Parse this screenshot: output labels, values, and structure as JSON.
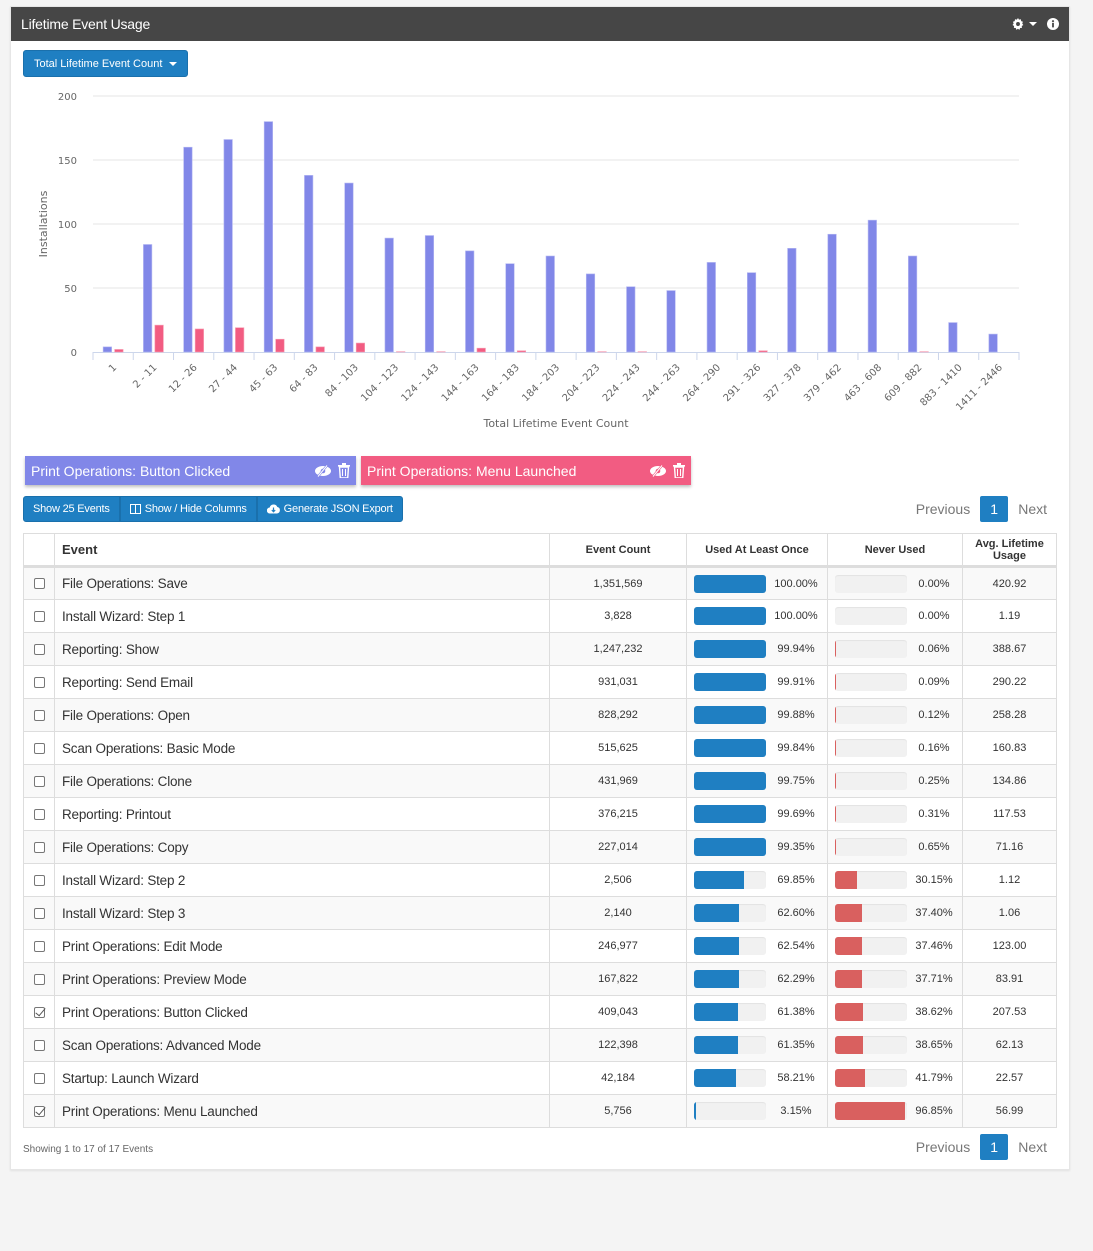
{
  "panel": {
    "title": "Lifetime Event Usage",
    "header_icons": [
      "gear-icon",
      "caret-down-icon",
      "info-icon"
    ],
    "metric_button": "Total Lifetime Event Count"
  },
  "chart_data": {
    "type": "bar",
    "title": "",
    "xlabel": "Total Lifetime Event Count",
    "ylabel": "Installations",
    "ylim": [
      0,
      200
    ],
    "yticks": [
      0,
      50,
      100,
      150,
      200
    ],
    "grid": true,
    "categories": [
      "1",
      "2 - 11",
      "12 - 26",
      "27 - 44",
      "45 - 63",
      "64 - 83",
      "84 - 103",
      "104 - 123",
      "124 - 143",
      "144 - 163",
      "164 - 183",
      "184 - 203",
      "204 - 223",
      "224 - 243",
      "244 - 263",
      "264 - 290",
      "291 - 326",
      "327 - 378",
      "379 - 462",
      "463 - 608",
      "609 - 882",
      "883 - 1410",
      "1411 - 2446"
    ],
    "series": [
      {
        "name": "Print Operations: Button Clicked",
        "color": "#8187e8",
        "values": [
          4,
          84,
          160,
          166,
          180,
          138,
          132,
          89,
          91,
          79,
          69,
          75,
          61,
          51,
          48,
          70,
          62,
          81,
          92,
          103,
          75,
          23,
          14
        ]
      },
      {
        "name": "Print Operations: Menu Launched",
        "color": "#f25c82",
        "values": [
          2,
          21,
          18,
          19,
          10,
          4,
          7,
          0.3,
          0.3,
          3,
          1,
          0,
          0.3,
          0.3,
          0,
          0,
          1,
          0,
          0,
          0,
          0.3,
          0,
          0
        ]
      }
    ]
  },
  "legend": [
    {
      "label": "Print Operations: Button Clicked",
      "color": "#8187e8"
    },
    {
      "label": "Print Operations: Menu Launched",
      "color": "#f25c82"
    }
  ],
  "toolbar": {
    "show_events": "Show 25 Events",
    "show_hide_columns": "Show / Hide Columns",
    "export": "Generate JSON Export"
  },
  "pagination": {
    "previous": "Previous",
    "current": "1",
    "next": "Next"
  },
  "table": {
    "headers": [
      "",
      "Event",
      "Event Count",
      "Used At Least Once",
      "Never Used",
      "Avg. Lifetime Usage"
    ],
    "rows": [
      {
        "checked": false,
        "event": "File Operations: Save",
        "count": "1,351,569",
        "used": 100.0,
        "used_label": "100.00%",
        "never": 0.0,
        "never_label": "0.00%",
        "avg": "420.92"
      },
      {
        "checked": false,
        "event": "Install Wizard: Step 1",
        "count": "3,828",
        "used": 100.0,
        "used_label": "100.00%",
        "never": 0.0,
        "never_label": "0.00%",
        "avg": "1.19"
      },
      {
        "checked": false,
        "event": "Reporting: Show",
        "count": "1,247,232",
        "used": 99.94,
        "used_label": "99.94%",
        "never": 0.06,
        "never_label": "0.06%",
        "avg": "388.67"
      },
      {
        "checked": false,
        "event": "Reporting: Send Email",
        "count": "931,031",
        "used": 99.91,
        "used_label": "99.91%",
        "never": 0.09,
        "never_label": "0.09%",
        "avg": "290.22"
      },
      {
        "checked": false,
        "event": "File Operations: Open",
        "count": "828,292",
        "used": 99.88,
        "used_label": "99.88%",
        "never": 0.12,
        "never_label": "0.12%",
        "avg": "258.28"
      },
      {
        "checked": false,
        "event": "Scan Operations: Basic Mode",
        "count": "515,625",
        "used": 99.84,
        "used_label": "99.84%",
        "never": 0.16,
        "never_label": "0.16%",
        "avg": "160.83"
      },
      {
        "checked": false,
        "event": "File Operations: Clone",
        "count": "431,969",
        "used": 99.75,
        "used_label": "99.75%",
        "never": 0.25,
        "never_label": "0.25%",
        "avg": "134.86"
      },
      {
        "checked": false,
        "event": "Reporting: Printout",
        "count": "376,215",
        "used": 99.69,
        "used_label": "99.69%",
        "never": 0.31,
        "never_label": "0.31%",
        "avg": "117.53"
      },
      {
        "checked": false,
        "event": "File Operations: Copy",
        "count": "227,014",
        "used": 99.35,
        "used_label": "99.35%",
        "never": 0.65,
        "never_label": "0.65%",
        "avg": "71.16"
      },
      {
        "checked": false,
        "event": "Install Wizard: Step 2",
        "count": "2,506",
        "used": 69.85,
        "used_label": "69.85%",
        "never": 30.15,
        "never_label": "30.15%",
        "avg": "1.12"
      },
      {
        "checked": false,
        "event": "Install Wizard: Step 3",
        "count": "2,140",
        "used": 62.6,
        "used_label": "62.60%",
        "never": 37.4,
        "never_label": "37.40%",
        "avg": "1.06"
      },
      {
        "checked": false,
        "event": "Print Operations: Edit Mode",
        "count": "246,977",
        "used": 62.54,
        "used_label": "62.54%",
        "never": 37.46,
        "never_label": "37.46%",
        "avg": "123.00"
      },
      {
        "checked": false,
        "event": "Print Operations: Preview Mode",
        "count": "167,822",
        "used": 62.29,
        "used_label": "62.29%",
        "never": 37.71,
        "never_label": "37.71%",
        "avg": "83.91"
      },
      {
        "checked": true,
        "event": "Print Operations: Button Clicked",
        "count": "409,043",
        "used": 61.38,
        "used_label": "61.38%",
        "never": 38.62,
        "never_label": "38.62%",
        "avg": "207.53"
      },
      {
        "checked": false,
        "event": "Scan Operations: Advanced Mode",
        "count": "122,398",
        "used": 61.35,
        "used_label": "61.35%",
        "never": 38.65,
        "never_label": "38.65%",
        "avg": "62.13"
      },
      {
        "checked": false,
        "event": "Startup: Launch Wizard",
        "count": "42,184",
        "used": 58.21,
        "used_label": "58.21%",
        "never": 41.79,
        "never_label": "41.79%",
        "avg": "22.57"
      },
      {
        "checked": true,
        "event": "Print Operations: Menu Launched",
        "count": "5,756",
        "used": 3.15,
        "used_label": "3.15%",
        "never": 96.85,
        "never_label": "96.85%",
        "avg": "56.99"
      }
    ]
  },
  "footer": {
    "info": "Showing 1 to 17 of 17 Events"
  }
}
